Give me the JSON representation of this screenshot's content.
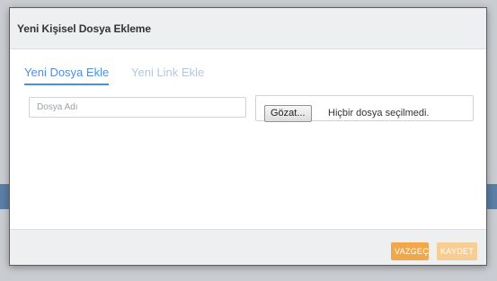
{
  "modal": {
    "title": "Yeni Kişisel Dosya Ekleme",
    "tabs": [
      {
        "label": "Yeni Dosya Ekle",
        "active": true
      },
      {
        "label": "Yeni Link Ekle",
        "active": false
      }
    ],
    "file_name_input": {
      "value": "",
      "placeholder": "Dosya Adı"
    },
    "file_picker": {
      "button_label": "Gözat...",
      "status_text": "Hiçbir dosya seçilmedi."
    },
    "footer": {
      "cancel_label": "VAZGEÇ",
      "save_label": "KAYDET"
    }
  },
  "colors": {
    "accent": "#4a90e2",
    "cancel": "#f0a84a",
    "save": "#f6cd93"
  }
}
